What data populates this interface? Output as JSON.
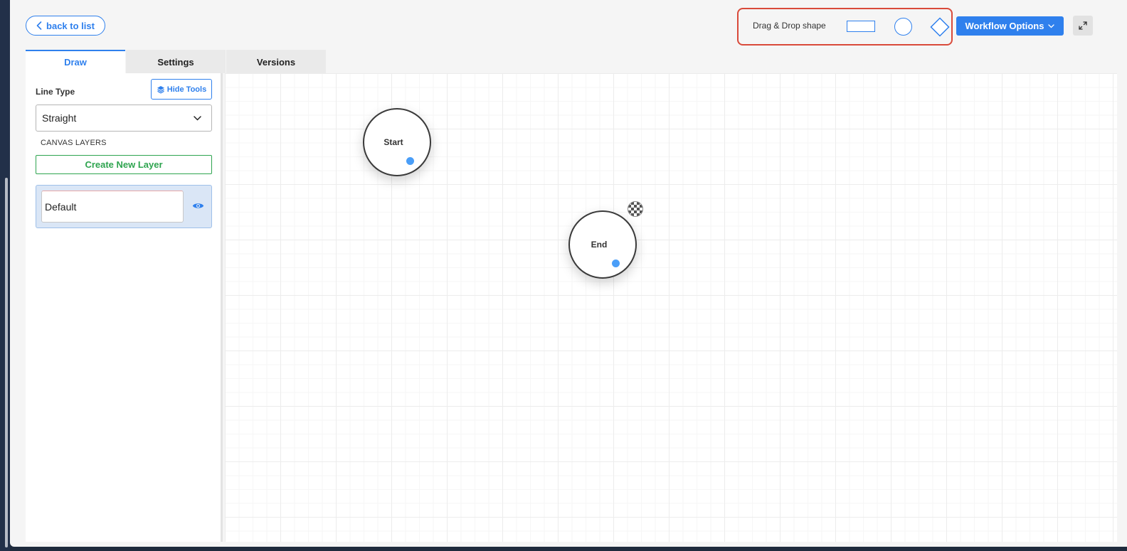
{
  "header": {
    "back_label": "back to list",
    "dnd_label": "Drag & Drop shape",
    "workflow_options_label": "Workflow Options"
  },
  "tabs": [
    {
      "label": "Draw",
      "active": true
    },
    {
      "label": "Settings",
      "active": false
    },
    {
      "label": "Versions",
      "active": false
    }
  ],
  "sidebar": {
    "line_type_label": "Line Type",
    "hide_tools_label": "Hide Tools",
    "line_type_value": "Straight",
    "canvas_layers_label": "CANVAS LAYERS",
    "create_layer_label": "Create New Layer",
    "layers": [
      {
        "name": "Default",
        "visible": true
      }
    ]
  },
  "canvas": {
    "nodes": [
      {
        "label": "Start",
        "shape": "circle"
      },
      {
        "label": "End",
        "shape": "circle"
      }
    ]
  },
  "colors": {
    "accent": "#2f80ed",
    "success": "#2ea44f",
    "highlight_border": "#d94a3a",
    "port": "#4a9ef8"
  },
  "icons": {
    "back": "chevron-left-icon",
    "workflow_options": "chevron-down-icon",
    "expand": "expand-icon",
    "hide_tools": "layers-icon",
    "select": "chevron-down-icon",
    "layer_visibility": "eye-icon"
  }
}
